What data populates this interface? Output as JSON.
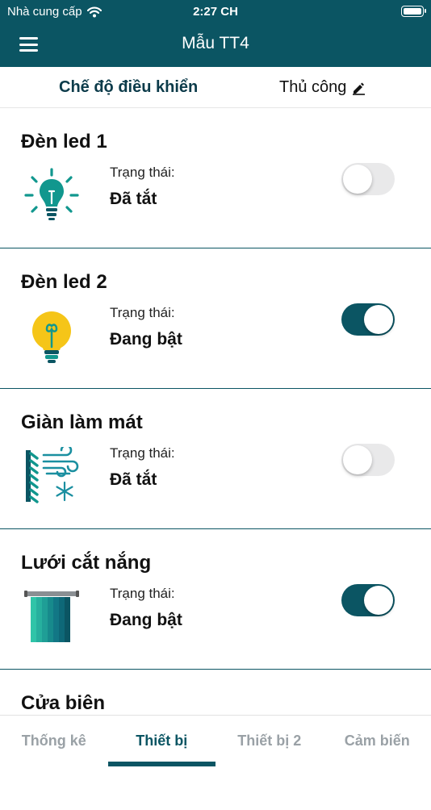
{
  "status_bar": {
    "carrier": "Nhà cung cấp",
    "time": "2:27 CH"
  },
  "app_bar": {
    "title": "Mẫu TT4"
  },
  "control_mode": {
    "label": "Chế độ điều khiển",
    "value": "Thủ công"
  },
  "devices": [
    {
      "name": "Đèn led 1",
      "status_label": "Trạng thái:",
      "status": "Đã tắt",
      "on": false,
      "icon": "led-bulb-icon"
    },
    {
      "name": "Đèn led 2",
      "status_label": "Trạng thái:",
      "status": "Đang bật",
      "on": true,
      "icon": "light-bulb-icon"
    },
    {
      "name": "Giàn làm mát",
      "status_label": "Trạng thái:",
      "status": "Đã tắt",
      "on": false,
      "icon": "cooling-fan-icon"
    },
    {
      "name": "Lưới cắt nắng",
      "status_label": "Trạng thái:",
      "status": "Đang bật",
      "on": true,
      "icon": "shade-net-icon"
    },
    {
      "name": "Cửa biên"
    }
  ],
  "tabs": [
    {
      "label": "Thống kê"
    },
    {
      "label": "Thiết bị"
    },
    {
      "label": "Thiết bị 2"
    },
    {
      "label": "Cảm biến"
    }
  ],
  "active_tab": "Thiết bị",
  "colors": {
    "primary": "#0b5563",
    "bulb_yellow": "#f5c518",
    "switch_off": "#e9e9ea"
  }
}
